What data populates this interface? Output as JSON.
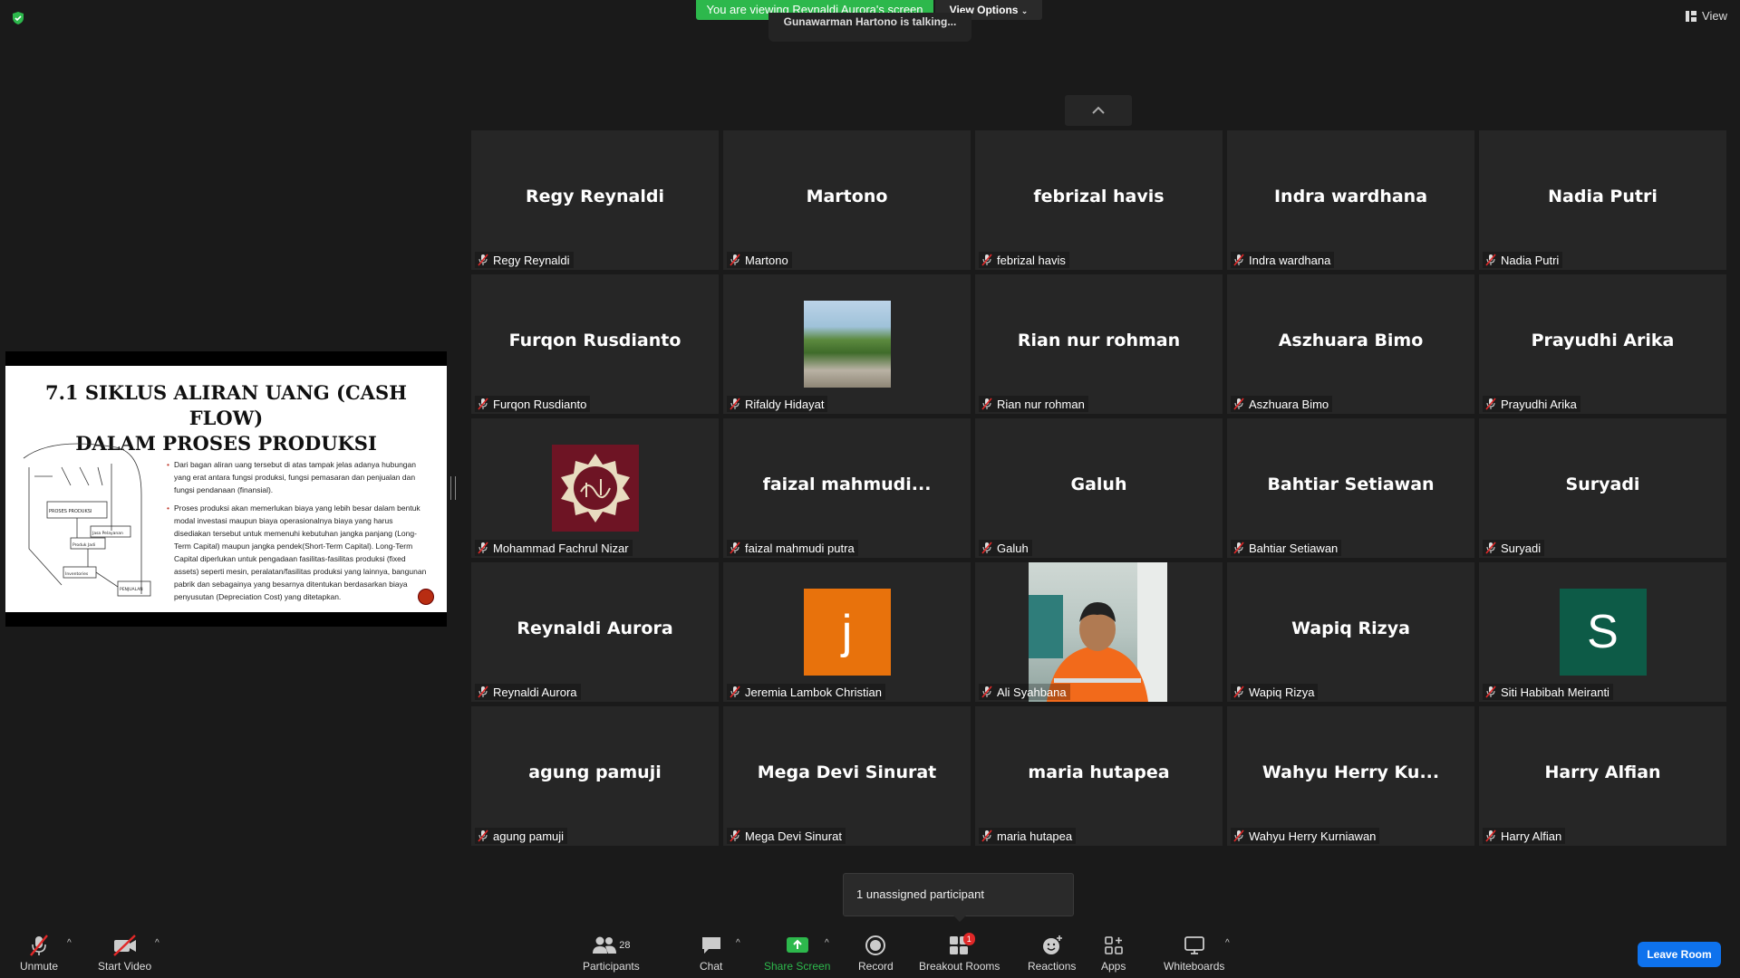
{
  "banner": {
    "viewing": "You are viewing Reynaldi Aurora's screen",
    "view_options": "View Options",
    "talking": "Gunawarman Hartono is talking...",
    "view": "View"
  },
  "slide": {
    "title_line1": "7.1 SIKLUS ALIRAN UANG (CASH FLOW)",
    "title_line2": "DALAM PROSES PRODUKSI",
    "bullet1": "Dari bagan aliran uang tersebut di atas tampak jelas adanya hubungan yang erat antara fungsi produksi, fungsi pemasaran dan penjualan dan fungsi pendanaan (finansial).",
    "bullet2": "Proses produksi akan memerlukan biaya yang lebih besar dalam bentuk modal investasi maupun biaya operasionalnya biaya yang harus disediakan tersebut untuk memenuhi kebutuhan jangka panjang (Long-Term Capital) maupun jangka pendek(Short-Term Capital). Long-Term Capital diperlukan untuk pengadaan fasilitas-fasilitas produksi (fixed assets) seperti mesin, peralatan/fasilitas produksi yang lainnya, bangunan pabrik dan sebagainya yang besarnya ditentukan berdasarkan biaya penyusutan (Depreciation Cost) yang ditetapkan.",
    "diagram_labels": {
      "proses": "PROSES PRODUKSI",
      "produk": "Produk Jadi",
      "jasa": "Jasa Pelayanan",
      "inventories": "Inventories",
      "penjualan": "PENJUALAN"
    }
  },
  "participants": [
    {
      "name": "Regy Reynaldi",
      "label": "Regy Reynaldi",
      "type": "name"
    },
    {
      "name": "Martono",
      "label": "Martono",
      "type": "name"
    },
    {
      "name": "febrizal havis",
      "label": "febrizal havis",
      "type": "name"
    },
    {
      "name": "Indra wardhana",
      "label": "Indra wardhana",
      "type": "name"
    },
    {
      "name": "Nadia Putri",
      "label": "Nadia Putri",
      "type": "name"
    },
    {
      "name": "Furqon Rusdianto",
      "label": "Furqon Rusdianto",
      "type": "name"
    },
    {
      "name": "",
      "label": "Rifaldy Hidayat",
      "type": "photo"
    },
    {
      "name": "Rian nur rohman",
      "label": "Rian nur rohman",
      "type": "name"
    },
    {
      "name": "Aszhuara Bimo",
      "label": "Aszhuara Bimo",
      "type": "name"
    },
    {
      "name": "Prayudhi Arika",
      "label": "Prayudhi Arika",
      "type": "name"
    },
    {
      "name": "",
      "label": "Mohammad Fachrul Nizar",
      "type": "calligraphy"
    },
    {
      "name": "faizal  mahmudi...",
      "label": "faizal mahmudi putra",
      "type": "name"
    },
    {
      "name": "Galuh",
      "label": "Galuh",
      "type": "name"
    },
    {
      "name": "Bahtiar Setiawan",
      "label": "Bahtiar Setiawan",
      "type": "name"
    },
    {
      "name": "Suryadi",
      "label": "Suryadi",
      "type": "name"
    },
    {
      "name": "Reynaldi Aurora",
      "label": "Reynaldi Aurora",
      "type": "name"
    },
    {
      "name": "j",
      "label": "Jeremia Lambok Christian",
      "type": "letter",
      "color": "#e8720c"
    },
    {
      "name": "",
      "label": "Ali Syahbana",
      "type": "video"
    },
    {
      "name": "Wapiq Rizya",
      "label": "Wapiq Rizya",
      "type": "name"
    },
    {
      "name": "S",
      "label": "Siti Habibah Meiranti",
      "type": "letter",
      "color": "#0d5b47"
    },
    {
      "name": "agung pamuji",
      "label": "agung pamuji",
      "type": "name"
    },
    {
      "name": "Mega Devi Sinurat",
      "label": "Mega Devi Sinurat",
      "type": "name"
    },
    {
      "name": "maria hutapea",
      "label": "maria hutapea",
      "type": "name"
    },
    {
      "name": "Wahyu Herry Ku...",
      "label": "Wahyu Herry Kurniawan",
      "type": "name"
    },
    {
      "name": "Harry Alfian",
      "label": "Harry Alfian",
      "type": "name"
    }
  ],
  "popup": {
    "unassigned": "1 unassigned participant"
  },
  "toolbar": {
    "unmute": "Unmute",
    "start_video": "Start Video",
    "participants": "Participants",
    "participants_count": "28",
    "chat": "Chat",
    "share_screen": "Share Screen",
    "record": "Record",
    "breakout_rooms": "Breakout Rooms",
    "breakout_badge": "1",
    "reactions": "Reactions",
    "apps": "Apps",
    "whiteboards": "Whiteboards",
    "leave_room": "Leave Room"
  },
  "colors": {
    "accent_green": "#2db84c",
    "leave_blue": "#0e72ed",
    "mute_red": "#e02828"
  }
}
